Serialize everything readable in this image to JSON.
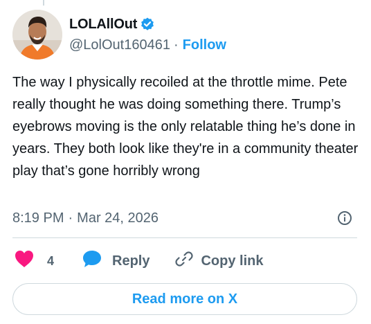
{
  "author": {
    "display_name": "LOLAllOut",
    "handle": "@LolOut160461",
    "separator": "·",
    "follow_label": "Follow",
    "verified": true
  },
  "tweet": {
    "text": "The way I physically recoiled at the throttle mime. Pete really thought he was doing something there. Trump’s eyebrows moving is the only relatable thing he’s done in years. They both look like they're in a community theater play that’s gone horribly wrong",
    "time": "8:19 PM",
    "separator": "·",
    "date": "Mar 24, 2026"
  },
  "actions": {
    "like_count": "4",
    "reply_label": "Reply",
    "copy_link_label": "Copy link"
  },
  "read_more_label": "Read more on X",
  "icons": {
    "verified": "verified-badge-icon",
    "info": "info-icon",
    "like": "heart-icon",
    "reply": "speech-bubble-icon",
    "copy_link": "link-icon"
  },
  "colors": {
    "accent": "#1d9bf0",
    "like": "#f91880",
    "secondary_text": "#536471",
    "primary_text": "#0f1419",
    "border": "#cfd9de"
  }
}
